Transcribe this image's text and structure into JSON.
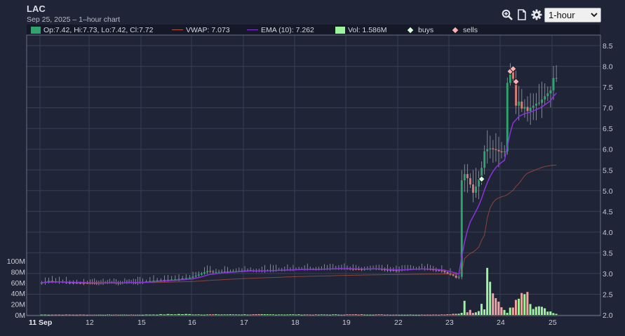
{
  "header": {
    "title": "LAC",
    "subtitle": "Sep 25, 2025 – 1–hour chart"
  },
  "toolbar": {
    "icons": [
      "zoom-icon",
      "document-icon",
      "gear-icon"
    ],
    "interval": "1-hour"
  },
  "legend": {
    "ohlc": "Op:7.42, Hi:7.73, Lo:7.42, Cl:7.72",
    "vwap": "VWAP: 7.073",
    "ema": "EMA (10): 7.262",
    "vol": "Vol: 1.586M",
    "buys": "buys",
    "sells": "sells"
  },
  "colors": {
    "background": "#1f2436",
    "legend_bg": "#141827",
    "grid": "#3a4054",
    "up": "#2fa56d",
    "down": "#dc7c78",
    "vol_up": "#9bf59b",
    "vol_down": "#f5a3a3",
    "ema": "#8a33dd",
    "vwap": "#b9533f",
    "buy_marker": "#ddffdd",
    "sell_marker": "#ffb0b0"
  },
  "chart_data": {
    "type": "candlestick",
    "x_ticks": [
      "11 Sep",
      "12",
      "15",
      "16",
      "17",
      "18",
      "19",
      "22",
      "23",
      "24",
      "25"
    ],
    "y_ticks": [
      "2.0",
      "2.5",
      "3.0",
      "3.5",
      "4.0",
      "4.5",
      "5.0",
      "5.5",
      "6.0",
      "6.5",
      "7.0",
      "7.5",
      "8.0",
      "8.5"
    ],
    "ylim": [
      2.0,
      8.75
    ],
    "volume_ticks": [
      "0M",
      "20M",
      "40M",
      "60M",
      "80M",
      "100M"
    ],
    "volume_lim": [
      0,
      100
    ],
    "grid": true,
    "last": {
      "open": 7.42,
      "high": 7.73,
      "low": 7.42,
      "close": 7.72,
      "vwap": 7.073,
      "ema10": 7.262,
      "volume_m": 1.586
    },
    "price_path": [
      [
        0,
        2.76
      ],
      [
        3,
        2.82
      ],
      [
        8,
        2.78
      ],
      [
        12,
        2.77
      ],
      [
        18,
        2.76
      ],
      [
        24,
        2.79
      ],
      [
        28,
        2.76
      ],
      [
        32,
        2.8
      ],
      [
        36,
        2.77
      ],
      [
        40,
        2.81
      ],
      [
        44,
        2.84
      ],
      [
        48,
        2.86
      ],
      [
        52,
        2.9
      ],
      [
        54,
        2.95
      ],
      [
        56,
        3.0
      ],
      [
        58,
        3.06
      ],
      [
        60,
        3.03
      ],
      [
        64,
        3.05
      ],
      [
        68,
        3.06
      ],
      [
        72,
        3.08
      ],
      [
        76,
        3.06
      ],
      [
        80,
        3.08
      ],
      [
        84,
        3.09
      ],
      [
        88,
        3.1
      ],
      [
        92,
        3.11
      ],
      [
        96,
        3.1
      ],
      [
        100,
        3.12
      ],
      [
        104,
        3.13
      ],
      [
        108,
        3.11
      ],
      [
        112,
        3.1
      ],
      [
        116,
        3.12
      ],
      [
        120,
        3.09
      ],
      [
        124,
        3.07
      ],
      [
        128,
        3.11
      ],
      [
        132,
        3.12
      ],
      [
        136,
        3.1
      ],
      [
        140,
        3.06
      ],
      [
        142,
        3.0
      ],
      [
        144,
        2.95
      ],
      [
        145,
        2.9
      ],
      [
        146,
        2.92
      ],
      [
        147,
        5.25
      ],
      [
        148,
        5.4
      ],
      [
        149,
        5.3
      ],
      [
        150,
        5.15
      ],
      [
        151,
        4.95
      ],
      [
        152,
        5.1
      ],
      [
        153,
        5.28
      ],
      [
        154,
        5.55
      ],
      [
        155,
        5.95
      ],
      [
        156,
        6.0
      ],
      [
        157,
        6.02
      ],
      [
        158,
        6.0
      ],
      [
        159,
        5.98
      ],
      [
        160,
        5.95
      ],
      [
        161,
        5.93
      ],
      [
        162,
        5.95
      ],
      [
        163,
        7.6
      ],
      [
        164,
        7.88
      ],
      [
        165,
        7.7
      ],
      [
        166,
        7.05
      ],
      [
        167,
        7.15
      ],
      [
        168,
        6.98
      ],
      [
        169,
        7.02
      ],
      [
        170,
        6.92
      ],
      [
        171,
        7.0
      ],
      [
        172,
        7.05
      ],
      [
        173,
        7.1
      ],
      [
        174,
        7.12
      ],
      [
        175,
        7.2
      ],
      [
        176,
        7.28
      ],
      [
        177,
        7.35
      ],
      [
        178,
        7.42
      ],
      [
        179,
        7.72
      ]
    ],
    "volume_path": [
      [
        0,
        0.6
      ],
      [
        14,
        0.5
      ],
      [
        28,
        0.6
      ],
      [
        38,
        0.5
      ],
      [
        48,
        1.5
      ],
      [
        56,
        1.0
      ],
      [
        68,
        1.0
      ],
      [
        84,
        1.0
      ],
      [
        96,
        0.7
      ],
      [
        112,
        1.0
      ],
      [
        126,
        0.5
      ],
      [
        140,
        0.8
      ],
      [
        145,
        2.0
      ],
      [
        146,
        5.0
      ],
      [
        147,
        30.0
      ],
      [
        148,
        8.0
      ],
      [
        150,
        6.0
      ],
      [
        152,
        10.0
      ],
      [
        153,
        25.0
      ],
      [
        154,
        18.0
      ],
      [
        155,
        80.0
      ],
      [
        156,
        65.0
      ],
      [
        157,
        45.0
      ],
      [
        158,
        30.0
      ],
      [
        159,
        18.0
      ],
      [
        160,
        14.0
      ],
      [
        162,
        6.0
      ],
      [
        163,
        10.0
      ],
      [
        164,
        12.0
      ],
      [
        165,
        28.0
      ],
      [
        166,
        22.0
      ],
      [
        167,
        35.0
      ],
      [
        168,
        40.0
      ],
      [
        169,
        30.0
      ],
      [
        170,
        15.0
      ],
      [
        171,
        12.0
      ],
      [
        172,
        15.0
      ],
      [
        174,
        12.0
      ],
      [
        176,
        6.0
      ],
      [
        179,
        1.6
      ]
    ],
    "trades": [
      {
        "type": "buy",
        "bar": 153,
        "price": 5.28
      },
      {
        "type": "sell",
        "bar": 163,
        "price": 7.88
      },
      {
        "type": "sell",
        "bar": 164,
        "price": 7.94
      },
      {
        "type": "sell",
        "bar": 165,
        "price": 7.63
      }
    ]
  }
}
